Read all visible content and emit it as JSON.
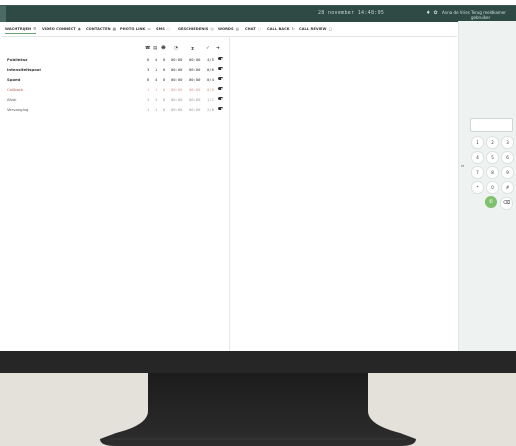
{
  "topbar": {
    "date": "28 november 14:48:05",
    "icons": [
      "bell-icon",
      "gear-icon"
    ],
    "user": "Anna de Vries",
    "logout": "Terug meldkamer gebruiker"
  },
  "tabs": [
    {
      "label": "WACHTRIJEN",
      "icon": "☰",
      "active": true
    },
    {
      "label": "VIDEO CONNECT",
      "icon": "◉",
      "active": false
    },
    {
      "label": "CONTACTEN",
      "icon": "▦",
      "active": false
    },
    {
      "label": "PHOTO LINK",
      "icon": "▭",
      "active": false
    },
    {
      "label": "SMS",
      "icon": "◌",
      "active": false
    },
    {
      "label": "GESCHIEDENIS",
      "icon": "◷",
      "active": false
    },
    {
      "label": "WORDS",
      "icon": "▤",
      "active": false
    },
    {
      "label": "CHAT",
      "icon": "◌",
      "active": false
    },
    {
      "label": "CALL BACK",
      "icon": "↻",
      "active": false
    },
    {
      "label": "CALL REVIEW",
      "icon": "▢",
      "active": false
    }
  ],
  "queue_headers": [
    "phone-icon",
    "message-icon",
    "agents-icon",
    "timer-icon",
    "hourglass-icon",
    "check-icon",
    "logout-icon"
  ],
  "queues": [
    {
      "name": "Publieksz",
      "calls": "6",
      "agents": "4",
      "waiting": "0",
      "max_wait": "00:00",
      "avg_wait": "00:00",
      "service": "4/5",
      "style": "bold"
    },
    {
      "name": "Intensiteitspool",
      "calls": "3",
      "agents": "1",
      "waiting": "0",
      "max_wait": "00:00",
      "avg_wait": "00:00",
      "service": "0/6",
      "style": "bold"
    },
    {
      "name": "Spoed",
      "calls": "6",
      "agents": "4",
      "waiting": "0",
      "max_wait": "00:00",
      "avg_wait": "00:00",
      "service": "0/4",
      "style": "bold"
    },
    {
      "name": "Callback",
      "calls": "1",
      "agents": "1",
      "waiting": "0",
      "max_wait": "00:00",
      "avg_wait": "00:00",
      "service": "0/0",
      "style": "red"
    },
    {
      "name": "Afval",
      "calls": "4",
      "agents": "4",
      "waiting": "0",
      "max_wait": "00:00",
      "avg_wait": "00:00",
      "service": "1/1",
      "style": "muted"
    },
    {
      "name": "Vervanging",
      "calls": "1",
      "agents": "1",
      "waiting": "0",
      "max_wait": "00:00",
      "avg_wait": "00:00",
      "service": "2/8",
      "style": "muted"
    }
  ],
  "dialer": {
    "input_value": "",
    "keys": [
      "1",
      "2",
      "3",
      "4",
      "5",
      "6",
      "7",
      "8",
      "9",
      "*",
      "0",
      "#"
    ],
    "call_icon": "phone-icon",
    "delete_icon": "backspace-icon",
    "collapse_icon": "chevron-icon"
  }
}
